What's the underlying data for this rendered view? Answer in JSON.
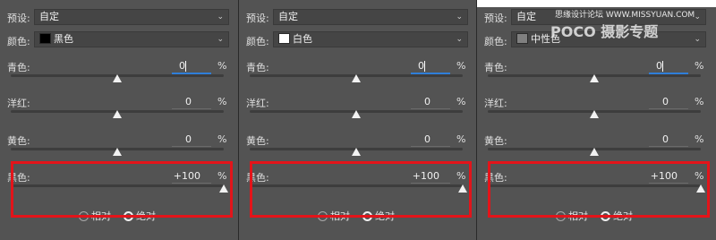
{
  "panels": [
    {
      "preset_label": "预设:",
      "preset_value": "自定",
      "color_label": "颜色:",
      "color_value": "黑色",
      "swatch": "#000000",
      "sliders": [
        {
          "label": "青色:",
          "value": "0",
          "unit": "%",
          "position": 0.5,
          "active": true
        },
        {
          "label": "洋红:",
          "value": "0",
          "unit": "%",
          "position": 0.5,
          "active": false
        },
        {
          "label": "黄色:",
          "value": "0",
          "unit": "%",
          "position": 0.5,
          "active": false
        },
        {
          "label": "黑色:",
          "value": "+100",
          "unit": "%",
          "position": 1.0,
          "active": false
        }
      ],
      "radio_relative": "相对",
      "radio_absolute": "绝对",
      "selected": "absolute"
    },
    {
      "preset_label": "预设:",
      "preset_value": "自定",
      "color_label": "颜色:",
      "color_value": "白色",
      "swatch": "#ffffff",
      "sliders": [
        {
          "label": "青色:",
          "value": "0",
          "unit": "%",
          "position": 0.5,
          "active": true
        },
        {
          "label": "洋红:",
          "value": "0",
          "unit": "%",
          "position": 0.5,
          "active": false
        },
        {
          "label": "黄色:",
          "value": "0",
          "unit": "%",
          "position": 0.5,
          "active": false
        },
        {
          "label": "黑色:",
          "value": "+100",
          "unit": "%",
          "position": 1.0,
          "active": false
        }
      ],
      "radio_relative": "相对",
      "radio_absolute": "绝对",
      "selected": "absolute"
    },
    {
      "preset_label": "预设:",
      "preset_value": "自定",
      "color_label": "颜色:",
      "color_value": "中性色",
      "swatch": "#808080",
      "sliders": [
        {
          "label": "青色:",
          "value": "0",
          "unit": "%",
          "position": 0.5,
          "active": true
        },
        {
          "label": "洋红:",
          "value": "0",
          "unit": "%",
          "position": 0.5,
          "active": false
        },
        {
          "label": "黄色:",
          "value": "0",
          "unit": "%",
          "position": 0.5,
          "active": false
        },
        {
          "label": "黑色:",
          "value": "+100",
          "unit": "%",
          "position": 1.0,
          "active": false
        }
      ],
      "radio_relative": "相对",
      "radio_absolute": "绝对",
      "selected": "absolute"
    }
  ],
  "watermark": {
    "site": "思缘设计论坛 WWW.MISSYUAN.COM",
    "brand": "POCO 摄影专题"
  },
  "colors": {
    "panel_bg": "#535353",
    "highlight_box": "#e3141a",
    "active_field": "#2f7ed8"
  }
}
